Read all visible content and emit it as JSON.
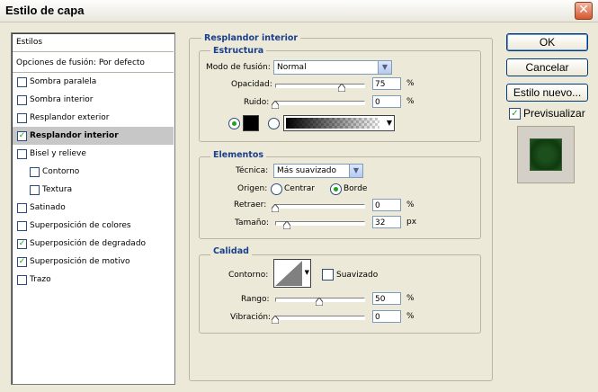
{
  "window": {
    "title": "Estilo de capa"
  },
  "styles_panel": {
    "header": "Estilos",
    "blend_options": "Opciones de fusión: Por defecto",
    "items": [
      {
        "label": "Sombra paralela",
        "checked": false
      },
      {
        "label": "Sombra interior",
        "checked": false
      },
      {
        "label": "Resplandor exterior",
        "checked": false
      },
      {
        "label": "Resplandor interior",
        "checked": true,
        "selected": true
      },
      {
        "label": "Bisel y relieve",
        "checked": false
      },
      {
        "label": "Contorno",
        "checked": false,
        "indent": true
      },
      {
        "label": "Textura",
        "checked": false,
        "indent": true
      },
      {
        "label": "Satinado",
        "checked": false
      },
      {
        "label": "Superposición de colores",
        "checked": false
      },
      {
        "label": "Superposición de degradado",
        "checked": true
      },
      {
        "label": "Superposición de motivo",
        "checked": true
      },
      {
        "label": "Trazo",
        "checked": false
      }
    ]
  },
  "panel_title": "Resplandor interior",
  "estructura": {
    "title": "Estructura",
    "blend_mode_label": "Modo de fusión:",
    "blend_mode_value": "Normal",
    "opacity_label": "Opacidad:",
    "opacity_value": "75",
    "opacity_unit": "%",
    "noise_label": "Ruido:",
    "noise_value": "0",
    "noise_unit": "%"
  },
  "elementos": {
    "title": "Elementos",
    "technique_label": "Técnica:",
    "technique_value": "Más suavizado",
    "source_label": "Origen:",
    "source_center": "Centrar",
    "source_edge": "Borde",
    "choke_label": "Retraer:",
    "choke_value": "0",
    "choke_unit": "%",
    "size_label": "Tamaño:",
    "size_value": "32",
    "size_unit": "px"
  },
  "calidad": {
    "title": "Calidad",
    "contour_label": "Contorno:",
    "antialias_label": "Suavizado",
    "range_label": "Rango:",
    "range_value": "50",
    "range_unit": "%",
    "jitter_label": "Vibración:",
    "jitter_value": "0",
    "jitter_unit": "%"
  },
  "buttons": {
    "ok": "OK",
    "cancel": "Cancelar",
    "new_style": "Estilo nuevo...",
    "preview": "Previsualizar"
  },
  "colors": {
    "glow_color": "#000000",
    "accent_title": "#1a3f8c"
  },
  "slider_levels": {
    "opacity": 0.75,
    "noise": 0,
    "choke": 0,
    "size": 0.13,
    "range": 0.5,
    "jitter": 0
  }
}
